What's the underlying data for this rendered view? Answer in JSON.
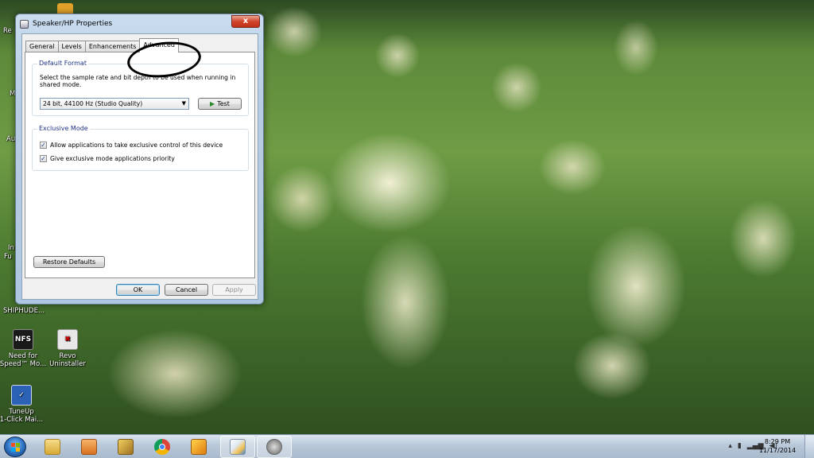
{
  "window": {
    "title": "Speaker/HP Properties",
    "close_label": "x",
    "tabs": [
      {
        "label": "General"
      },
      {
        "label": "Levels"
      },
      {
        "label": "Enhancements"
      },
      {
        "label": "Advanced"
      }
    ],
    "active_tab": "Advanced",
    "default_format": {
      "title": "Default Format",
      "description": "Select the sample rate and bit depth to be used when running in shared mode.",
      "selected_format": "24 bit, 44100 Hz (Studio Quality)",
      "test_label": "Test"
    },
    "exclusive_mode": {
      "title": "Exclusive Mode",
      "options": [
        {
          "label": "Allow applications to take exclusive control of this device",
          "checked": true
        },
        {
          "label": "Give exclusive mode applications priority",
          "checked": true
        }
      ]
    },
    "restore_defaults_label": "Restore Defaults",
    "ok_label": "OK",
    "cancel_label": "Cancel",
    "apply_label": "Apply"
  },
  "desktop": {
    "icons": [
      {
        "label_line1": "Need for",
        "label_line2": "Speed™ Mo...",
        "icon": "need-for-speed-icon"
      },
      {
        "label_line1": "Revo",
        "label_line2": "Uninstaller",
        "icon": "revo-uninstaller-icon"
      },
      {
        "label_line1": "TuneUp",
        "label_line2": "1-Click Mai...",
        "icon": "tuneup-icon"
      }
    ],
    "partial_labels": [
      "Re",
      "M",
      "Au",
      "In",
      "Fu",
      "SHIPHUDE..."
    ]
  },
  "taskbar": {
    "pinned": [
      {
        "name": "explorer",
        "icon": "folder-icon",
        "color": "#e8c45a"
      },
      {
        "name": "media-player",
        "icon": "media-player-icon",
        "color": "#e07a2a"
      },
      {
        "name": "app-3",
        "icon": "tools-icon",
        "color": "#c9a23a"
      },
      {
        "name": "chrome",
        "icon": "chrome-icon",
        "color": "#3a9a3a"
      },
      {
        "name": "app-5",
        "icon": "paint-icon",
        "color": "#f0a020"
      },
      {
        "name": "sound",
        "icon": "speaker-icon",
        "color": "#7a7a7a"
      }
    ],
    "clock_time": "8:29 PM",
    "clock_date": "11/17/2014"
  },
  "colors": {
    "accent": "#1e3287",
    "close_button": "#c12f17"
  }
}
